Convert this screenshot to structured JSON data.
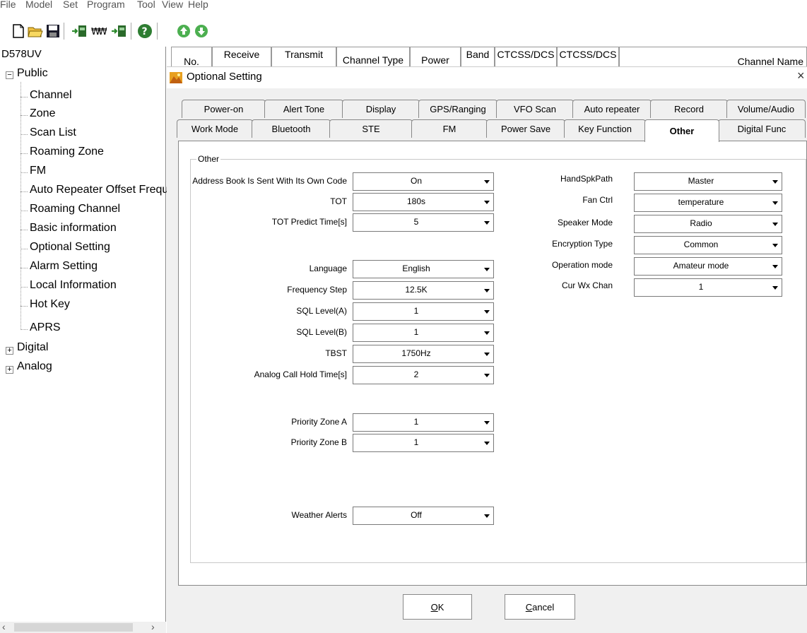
{
  "menubar": {
    "items": [
      "File",
      "Model",
      "Set",
      "Program",
      "Tool",
      "View",
      "Help"
    ]
  },
  "toolbar": {
    "buttons": [
      "new-icon",
      "open-icon",
      "save-icon",
      "read-from-radio-icon",
      "frequency-icon",
      "write-to-radio-icon",
      "help-icon",
      "upload-icon",
      "download-icon"
    ]
  },
  "tree": {
    "root": "D578UV",
    "public": {
      "label": "Public",
      "children": [
        "Channel",
        "Zone",
        "Scan List",
        "Roaming Zone",
        "FM",
        "Auto Repeater Offset Frequer",
        "Roaming Channel",
        "Basic information",
        "Optional Setting",
        "Alarm Setting",
        "Local Information",
        "Hot Key",
        "APRS"
      ]
    },
    "digital": "Digital",
    "analog": "Analog"
  },
  "grid": {
    "headers": [
      "No.",
      "Receive",
      "Transmit",
      "Channel Type",
      "Power",
      "Band",
      "CTCSS/DCS",
      "CTCSS/DCS",
      "Channel Name"
    ]
  },
  "dialog": {
    "title": "Optional Setting",
    "close": "×",
    "tabs_back": [
      "Power-on",
      "Alert Tone",
      "Display",
      "GPS/Ranging",
      "VFO Scan",
      "Auto repeater",
      "Record",
      "Volume/Audio"
    ],
    "tabs_front": [
      "Work Mode",
      "Bluetooth",
      "STE",
      "FM",
      "Power Save",
      "Key Function",
      "Other",
      "Digital Func"
    ],
    "active_tab": "Other",
    "group_title": "Other",
    "left_fields": [
      {
        "label": "Address Book Is Sent With Its Own Code",
        "value": "On"
      },
      {
        "label": "TOT",
        "value": "180s"
      },
      {
        "label": "TOT Predict Time[s]",
        "value": "5"
      },
      {
        "label": "Language",
        "value": "English"
      },
      {
        "label": "Frequency Step",
        "value": "12.5K"
      },
      {
        "label": "SQL Level(A)",
        "value": "1"
      },
      {
        "label": "SQL Level(B)",
        "value": "1"
      },
      {
        "label": "TBST",
        "value": "1750Hz"
      },
      {
        "label": "Analog Call Hold Time[s]",
        "value": "2"
      },
      {
        "label": "Priority Zone A",
        "value": "1"
      },
      {
        "label": "Priority Zone B",
        "value": "1"
      },
      {
        "label": "Weather Alerts",
        "value": "Off"
      }
    ],
    "right_fields": [
      {
        "label": "HandSpkPath",
        "value": "Master"
      },
      {
        "label": "Fan Ctrl",
        "value": "temperature"
      },
      {
        "label": "Speaker Mode",
        "value": "Radio"
      },
      {
        "label": "Encryption Type",
        "value": "Common"
      },
      {
        "label": "Operation mode",
        "value": "Amateur mode"
      },
      {
        "label": "Cur Wx Chan",
        "value": "1"
      }
    ],
    "ok_label_prefix": "",
    "ok_label_key": "O",
    "ok_label_rest": "K",
    "cancel_label_key": "C",
    "cancel_label_rest": "ancel"
  },
  "colors": {
    "dialog_bg": "#f0f0f0",
    "panel_bg": "#ffffff",
    "icon_green": "#3a9a3a",
    "icon_orange": "#e8a020"
  }
}
